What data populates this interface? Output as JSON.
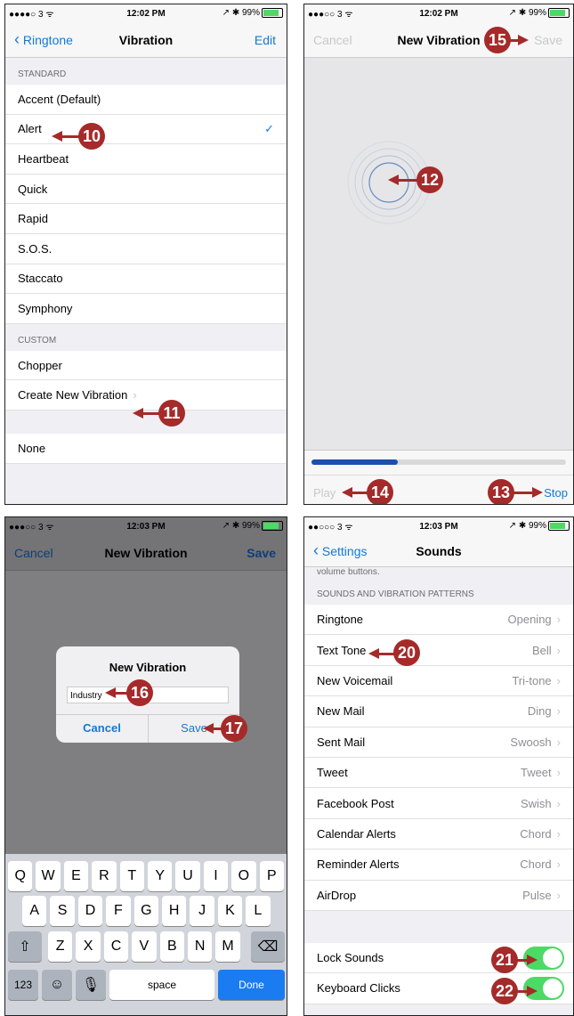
{
  "panel1": {
    "status": {
      "left": "●●●●○ 3 ᯤ",
      "time": "12:02 PM",
      "right": "↗ ✱ 99%"
    },
    "back": "Ringtone",
    "title": "Vibration",
    "edit": "Edit",
    "standard_header": "STANDARD",
    "standard": [
      "Accent (Default)",
      "Alert",
      "Heartbeat",
      "Quick",
      "Rapid",
      "S.O.S.",
      "Staccato",
      "Symphony"
    ],
    "custom_header": "CUSTOM",
    "custom": [
      "Chopper",
      "Create New Vibration"
    ],
    "none": "None",
    "callout_a": "10",
    "callout_b": "11"
  },
  "panel2": {
    "status": {
      "left": "●●●○○ 3 ᯤ",
      "time": "12:02 PM",
      "right": "↗ ✱ 99%"
    },
    "cancel": "Cancel",
    "title": "New Vibration",
    "save": "Save",
    "play": "Play",
    "stop": "Stop",
    "progress": 0.34,
    "callout_a": "15",
    "callout_b": "12",
    "callout_c": "14",
    "callout_d": "13"
  },
  "panel3": {
    "status": {
      "left": "●●●○○ 3 ᯤ",
      "time": "12:03 PM",
      "right": "↗ ✱ 99%"
    },
    "cancel": "Cancel",
    "title": "New Vibration",
    "save": "Save",
    "dialog_title": "New Vibration",
    "field_value": "Industry",
    "dialog_cancel": "Cancel",
    "dialog_save": "Save",
    "row1": [
      "Q",
      "W",
      "E",
      "R",
      "T",
      "Y",
      "U",
      "I",
      "O",
      "P"
    ],
    "row2": [
      "A",
      "S",
      "D",
      "F",
      "G",
      "H",
      "J",
      "K",
      "L"
    ],
    "row3": [
      "Z",
      "X",
      "C",
      "V",
      "B",
      "N",
      "M"
    ],
    "num": "123",
    "space": "space",
    "done": "Done",
    "callout_a": "16",
    "callout_b": "17"
  },
  "panel4": {
    "status": {
      "left": "●●○○○ 3 ᯤ",
      "time": "12:03 PM",
      "right": "↗ ✱ 99%"
    },
    "back": "Settings",
    "title": "Sounds",
    "top_text": "volume buttons.",
    "header": "SOUNDS AND VIBRATION PATTERNS",
    "rows": [
      {
        "label": "Ringtone",
        "value": "Opening"
      },
      {
        "label": "Text Tone",
        "value": "Bell"
      },
      {
        "label": "New Voicemail",
        "value": "Tri-tone"
      },
      {
        "label": "New Mail",
        "value": "Ding"
      },
      {
        "label": "Sent Mail",
        "value": "Swoosh"
      },
      {
        "label": "Tweet",
        "value": "Tweet"
      },
      {
        "label": "Facebook Post",
        "value": "Swish"
      },
      {
        "label": "Calendar Alerts",
        "value": "Chord"
      },
      {
        "label": "Reminder Alerts",
        "value": "Chord"
      },
      {
        "label": "AirDrop",
        "value": "Pulse"
      }
    ],
    "lock_sounds": "Lock Sounds",
    "keyboard_clicks": "Keyboard Clicks",
    "callout_a": "20",
    "callout_b": "21",
    "callout_c": "22"
  }
}
